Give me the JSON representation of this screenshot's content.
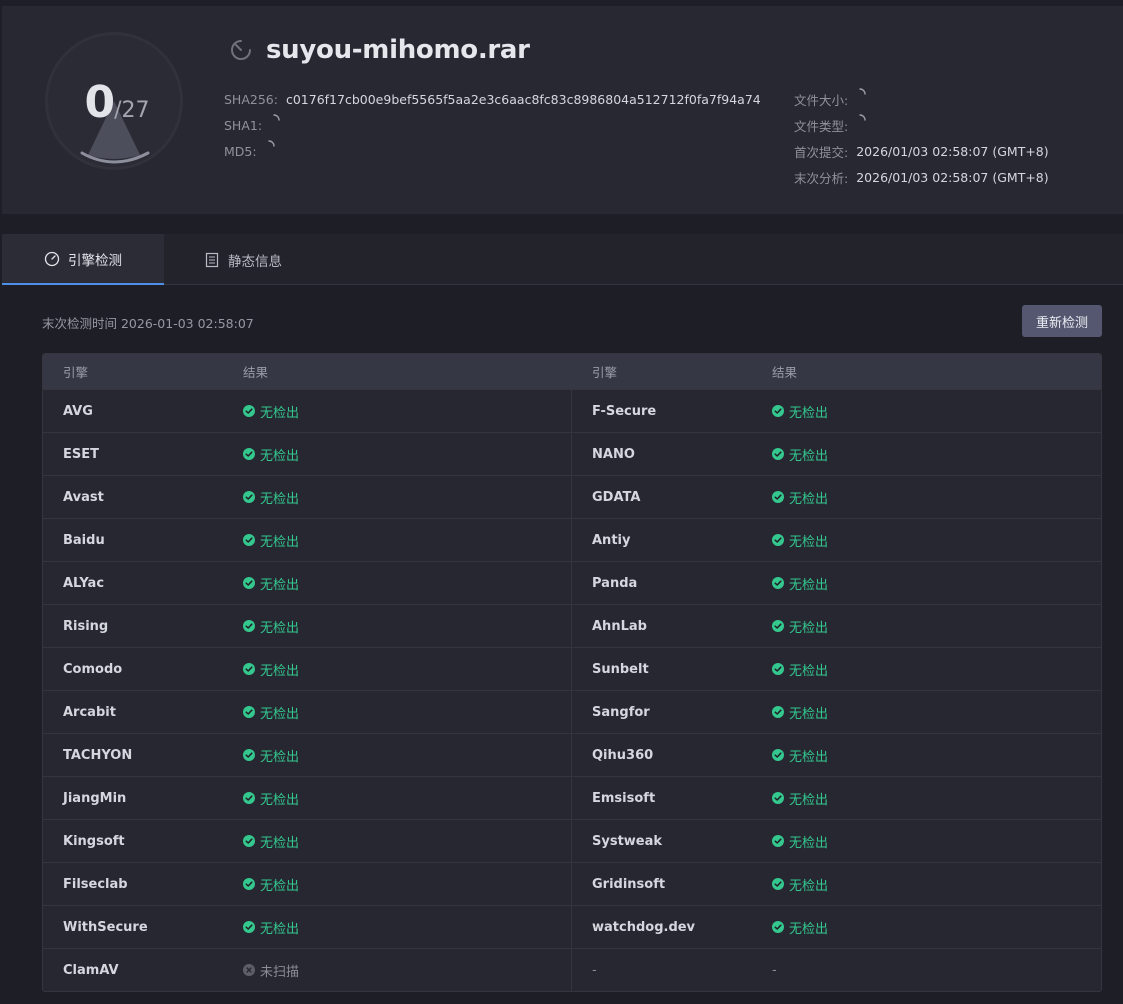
{
  "file": {
    "name": "suyou-mihomo.rar",
    "score": "0",
    "score_total": "/27"
  },
  "meta_left": [
    {
      "key": "SHA256:",
      "value": "c0176f17cb00e9bef5565f5aa2e3c6aac8fc83c8986804a512712f0fa7f94a74",
      "loading": false
    },
    {
      "key": "SHA1:",
      "value": "",
      "loading": true
    },
    {
      "key": "MD5:",
      "value": "",
      "loading": true
    }
  ],
  "meta_right": [
    {
      "key": "文件大小:",
      "value": "",
      "loading": true
    },
    {
      "key": "文件类型:",
      "value": "",
      "loading": true
    },
    {
      "key": "首次提交:",
      "value": "2026/01/03 02:58:07 (GMT+8)",
      "loading": false
    },
    {
      "key": "末次分析:",
      "value": "2026/01/03 02:58:07 (GMT+8)",
      "loading": false
    }
  ],
  "tabs": [
    {
      "label": "引擎检测",
      "icon": "gauge-icon",
      "active": true
    },
    {
      "label": "静态信息",
      "icon": "document-list-icon",
      "active": false
    }
  ],
  "scan": {
    "last_scan_label": "末次检测时间 2026-01-03 02:58:07",
    "rescan_label": "重新检测"
  },
  "table": {
    "headers": [
      "引擎",
      "结果",
      "引擎",
      "结果"
    ],
    "rows": [
      {
        "left": {
          "engine": "AVG",
          "result": "无检出",
          "status": "clean"
        },
        "right": {
          "engine": "F-Secure",
          "result": "无检出",
          "status": "clean"
        }
      },
      {
        "left": {
          "engine": "ESET",
          "result": "无检出",
          "status": "clean"
        },
        "right": {
          "engine": "NANO",
          "result": "无检出",
          "status": "clean"
        }
      },
      {
        "left": {
          "engine": "Avast",
          "result": "无检出",
          "status": "clean"
        },
        "right": {
          "engine": "GDATA",
          "result": "无检出",
          "status": "clean"
        }
      },
      {
        "left": {
          "engine": "Baidu",
          "result": "无检出",
          "status": "clean"
        },
        "right": {
          "engine": "Antiy",
          "result": "无检出",
          "status": "clean"
        }
      },
      {
        "left": {
          "engine": "ALYac",
          "result": "无检出",
          "status": "clean"
        },
        "right": {
          "engine": "Panda",
          "result": "无检出",
          "status": "clean"
        }
      },
      {
        "left": {
          "engine": "Rising",
          "result": "无检出",
          "status": "clean"
        },
        "right": {
          "engine": "AhnLab",
          "result": "无检出",
          "status": "clean"
        }
      },
      {
        "left": {
          "engine": "Comodo",
          "result": "无检出",
          "status": "clean"
        },
        "right": {
          "engine": "Sunbelt",
          "result": "无检出",
          "status": "clean"
        }
      },
      {
        "left": {
          "engine": "Arcabit",
          "result": "无检出",
          "status": "clean"
        },
        "right": {
          "engine": "Sangfor",
          "result": "无检出",
          "status": "clean"
        }
      },
      {
        "left": {
          "engine": "TACHYON",
          "result": "无检出",
          "status": "clean"
        },
        "right": {
          "engine": "Qihu360",
          "result": "无检出",
          "status": "clean"
        }
      },
      {
        "left": {
          "engine": "JiangMin",
          "result": "无检出",
          "status": "clean"
        },
        "right": {
          "engine": "Emsisoft",
          "result": "无检出",
          "status": "clean"
        }
      },
      {
        "left": {
          "engine": "Kingsoft",
          "result": "无检出",
          "status": "clean"
        },
        "right": {
          "engine": "Systweak",
          "result": "无检出",
          "status": "clean"
        }
      },
      {
        "left": {
          "engine": "Filseclab",
          "result": "无检出",
          "status": "clean"
        },
        "right": {
          "engine": "Gridinsoft",
          "result": "无检出",
          "status": "clean"
        }
      },
      {
        "left": {
          "engine": "WithSecure",
          "result": "无检出",
          "status": "clean"
        },
        "right": {
          "engine": "watchdog.dev",
          "result": "无检出",
          "status": "clean"
        }
      },
      {
        "left": {
          "engine": "ClamAV",
          "result": "未扫描",
          "status": "unscanned"
        },
        "right": {
          "engine": "-",
          "result": "-",
          "status": "empty"
        }
      }
    ]
  },
  "colors": {
    "clean": "#34c88f",
    "unscanned": "#8a8c96",
    "accent": "#4d8fe6",
    "button": "#555770"
  }
}
